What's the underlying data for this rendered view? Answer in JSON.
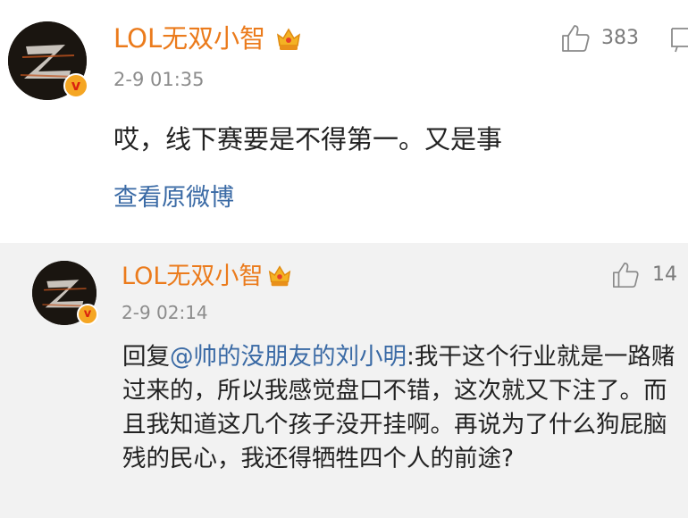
{
  "post": {
    "username": "LOL无双小智",
    "time": "2-9 01:35",
    "likes": "383",
    "text": "哎，线下赛要是不得第一。又是事",
    "view_link": "查看原微博"
  },
  "reply": {
    "username": "LOL无双小智",
    "time": "2-9 02:14",
    "likes": "14",
    "prefix": "回复",
    "mention": "@帅的没朋友的刘小明",
    "text": ":我干这个行业就是一路赌过来的，所以我感觉盘口不错，这次就又下注了。而且我知道这几个孩子没开挂啊。再说为了什么狗屁脑残的民心，我还得牺牲四个人的前途?"
  },
  "colors": {
    "username": "#eb7b1c",
    "link": "#3a6aa5",
    "time": "#8c8c8c",
    "reply_bg": "#f2f2f2"
  }
}
